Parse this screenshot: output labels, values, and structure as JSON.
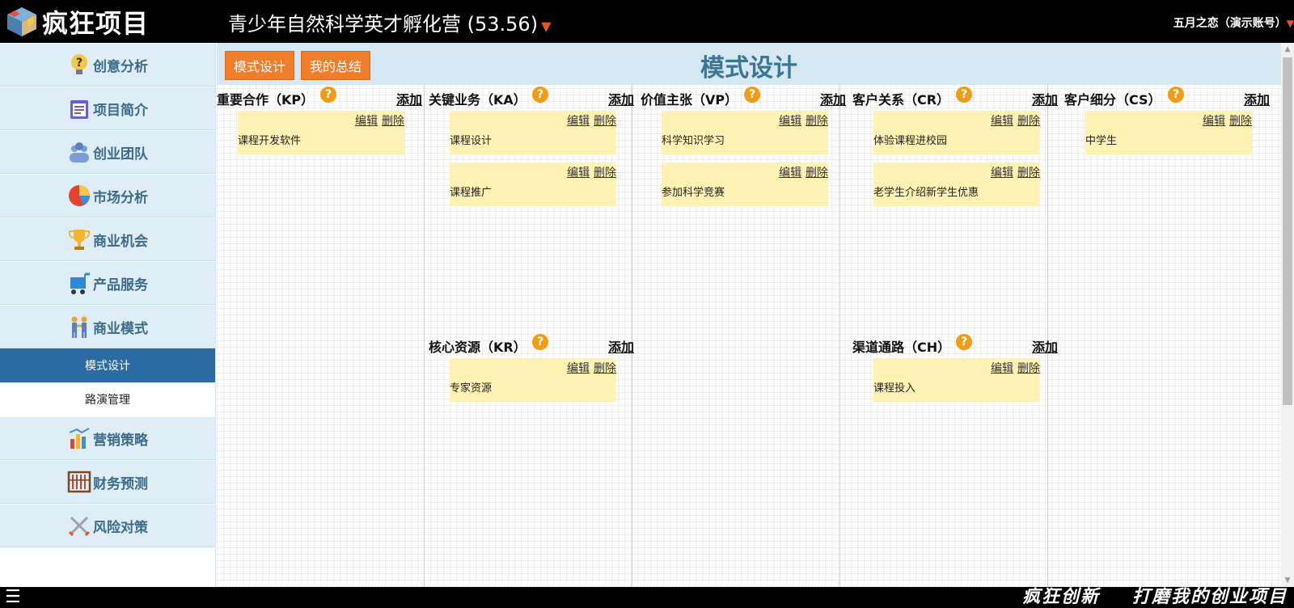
{
  "app": {
    "logo_text": "疯狂项目",
    "project_title": "青少年自然科学英才孵化营 (53.56)",
    "user": "五月之恋（演示账号）"
  },
  "sidebar": {
    "items": [
      {
        "label": "创意分析",
        "icon": "lightbulb-question-icon"
      },
      {
        "label": "项目简介",
        "icon": "clipboard-icon"
      },
      {
        "label": "创业团队",
        "icon": "team-icon"
      },
      {
        "label": "市场分析",
        "icon": "pie-chart-icon"
      },
      {
        "label": "商业机会",
        "icon": "trophy-icon"
      },
      {
        "label": "产品服务",
        "icon": "cart-icon"
      },
      {
        "label": "商业模式",
        "icon": "handshake-icon"
      }
    ],
    "subitems": [
      {
        "label": "模式设计",
        "active": true
      },
      {
        "label": "路演管理",
        "active": false
      }
    ],
    "items_after": [
      {
        "label": "营销策略",
        "icon": "bar-chart-icon"
      },
      {
        "label": "财务预测",
        "icon": "abacus-icon"
      },
      {
        "label": "风险对策",
        "icon": "crossed-swords-icon"
      }
    ]
  },
  "main": {
    "buttons": {
      "design": "模式设计",
      "summary": "我的总结"
    },
    "title": "模式设计",
    "help": "?",
    "add": "添加",
    "edit": "编辑",
    "delete": "删除",
    "blocks": {
      "kp": {
        "title": "重要合作（KP）",
        "notes": [
          "课程开发软件"
        ]
      },
      "ka": {
        "title": "关键业务（KA）",
        "notes": [
          "课程设计",
          "课程推广"
        ]
      },
      "kr": {
        "title": "核心资源（KR）",
        "notes": [
          "专家资源"
        ]
      },
      "vp": {
        "title": "价值主张（VP）",
        "notes": [
          "科学知识学习",
          "参加科学竞赛"
        ]
      },
      "cr": {
        "title": "客户关系（CR）",
        "notes": [
          "体验课程进校园",
          "老学生介绍新学生优惠"
        ]
      },
      "ch": {
        "title": "渠道通路（CH）",
        "notes": [
          "课程投入"
        ]
      },
      "cs": {
        "title": "客户细分（CS）",
        "notes": [
          "中学生"
        ]
      }
    }
  },
  "footer": {
    "menu": "☰",
    "slogan1": "疯狂创新",
    "slogan2": "打磨我的创业项目"
  },
  "colors": {
    "accent_orange": "#ef7d2a",
    "sidebar_bg": "#dfeef6",
    "active_blue": "#2b6aa3",
    "note_yellow": "#fff2b3",
    "title_blue": "#3a7696"
  }
}
